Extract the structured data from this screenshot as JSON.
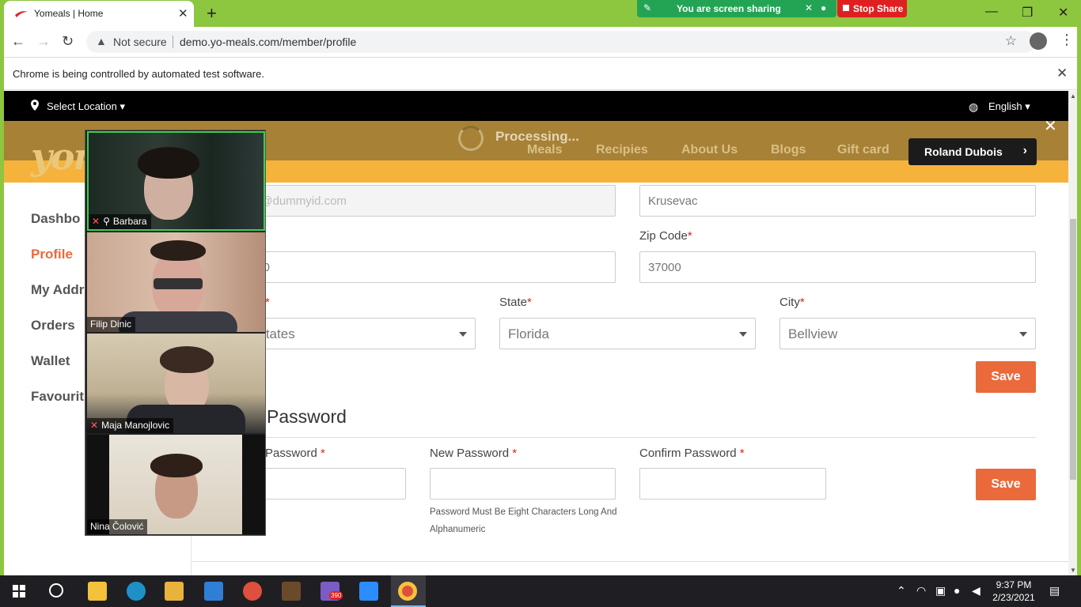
{
  "browser": {
    "tab_title": "Yomeals | Home",
    "not_secure": "Not secure",
    "url": "demo.yo-meals.com/member/profile",
    "infobar_message": "Chrome is being controlled by automated test software."
  },
  "screen_share": {
    "status": "You are screen sharing",
    "stop_label": "Stop Share"
  },
  "site": {
    "select_location": "Select Location",
    "language": "English",
    "logo_text": "yom",
    "processing": "Processing...",
    "nav": [
      "Meals",
      "Recipies",
      "About Us",
      "Blogs",
      "Gift card"
    ],
    "user_name": "Roland Dubois"
  },
  "sidebar": {
    "items": [
      {
        "label": "Dashbo",
        "active": false
      },
      {
        "label": "Profile",
        "active": true
      },
      {
        "label": "My Addr",
        "active": false
      },
      {
        "label": "Orders",
        "active": false
      },
      {
        "label": "Wallet",
        "active": false
      },
      {
        "label": "Favourit",
        "active": false
      }
    ]
  },
  "form": {
    "email_value": "er@dummyid.com",
    "city_value": "Krusevac",
    "label_no": "o",
    "phone_value": "000",
    "zip_label": "Zip Code",
    "zip_value": "37000",
    "country_value": "l States",
    "state_label": "State",
    "state_value": "Florida",
    "city_label": "City",
    "city_select_value": "Bellview",
    "save_label": "Save"
  },
  "password": {
    "title": "ge Password",
    "current_label": "Password",
    "new_label": "New Password",
    "confirm_label": "Confirm Password",
    "help": "Password Must Be Eight Characters Long And Alphanumeric",
    "save_label": "Save"
  },
  "participants": [
    {
      "name": "Barbara",
      "muted": true,
      "pinned": true
    },
    {
      "name": "Filip Dinic",
      "muted": false,
      "pinned": false
    },
    {
      "name": "Maja Manojlovic",
      "muted": true,
      "pinned": false
    },
    {
      "name": "Nina Čolović",
      "muted": false,
      "pinned": false
    }
  ],
  "taskbar": {
    "time": "9:37 PM",
    "date": "2/23/2021",
    "badge_count": "390"
  },
  "colors": {
    "accent": "#ea6a3c",
    "share_green": "#23a455",
    "stop_red": "#e02020",
    "nav_gold": "#a78135",
    "nav_yellow": "#f6b33c"
  }
}
